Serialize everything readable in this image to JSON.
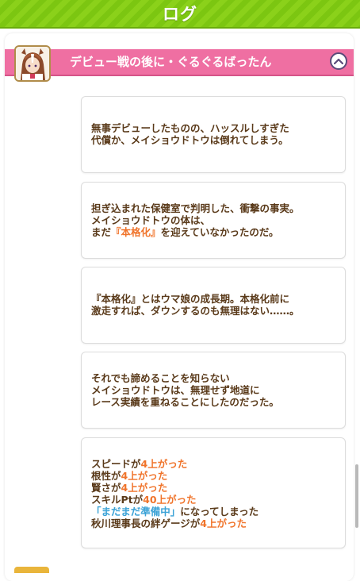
{
  "header": {
    "title": "ログ"
  },
  "chapter": {
    "title": "デビュー戦の後に・ぐるぐるばったん"
  },
  "cards": [
    {
      "lines": [
        "無事デビューしたものの、ハッスルしすぎた",
        "代償か、メイショウドトウは倒れてしまう。"
      ]
    },
    {
      "line1": "担ぎ込まれた保健室で判明した、衝撃の事実。",
      "line2": "メイショウドトウの体は、",
      "line3_before": "まだ",
      "line3_highlight": "『本格化』",
      "line3_after": "を迎えていなかったのだ。"
    },
    {
      "lines": [
        "『本格化』とはウマ娘の成長期。本格化前に",
        "激走すれば、ダウンするのも無理はない……。"
      ]
    },
    {
      "lines": [
        "それでも諦めることを知らない",
        "メイショウドトウは、無理せず地道に",
        "レース実績を重ねることにしたのだった。"
      ]
    }
  ],
  "results": {
    "speed_label": "スピードが",
    "speed_value": "4上がった",
    "guts_label": "根性が",
    "guts_value": "4上がった",
    "wisdom_label": "賢さが",
    "wisdom_value": "4上がった",
    "skill_label": "スキルPtが",
    "skill_value": "40上がった",
    "condition_name": "「まだまだ準備中」",
    "condition_text": "になってしまった",
    "bond_label": "秋川理事長の絆ゲージが",
    "bond_value": "4上がった"
  },
  "colors": {
    "header_green": "#7cc611",
    "chapter_pink": "#ef6fa2",
    "text_brown": "#5a3a1a",
    "highlight_orange": "#f0742b",
    "highlight_blue": "#3ba2d6"
  },
  "icons": {
    "collapse": "chevron-up-icon"
  }
}
